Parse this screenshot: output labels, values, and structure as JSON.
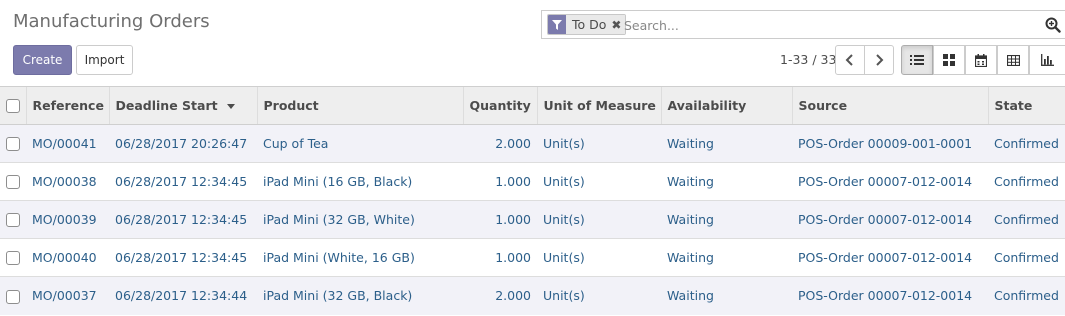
{
  "page": {
    "title": "Manufacturing Orders"
  },
  "buttons": {
    "create": "Create",
    "import": "Import"
  },
  "search": {
    "facet_value": "To Do",
    "facet_icon": "filter-icon",
    "placeholder": "Search...",
    "search_icon": "search-icon"
  },
  "pager": {
    "value": "1-33 / 33"
  },
  "views": [
    "list",
    "kanban",
    "calendar",
    "pivot",
    "graph"
  ],
  "active_view": "list",
  "colors": {
    "primary": "#7c7bad",
    "link": "#2c5f8a",
    "header_bg": "#eeeeee",
    "row_alt_bg": "#f2f2f8"
  },
  "table": {
    "columns": [
      "Reference",
      "Deadline Start",
      "Product",
      "Quantity",
      "Unit of Measure",
      "Availability",
      "Source",
      "State"
    ],
    "sorted_column": "Deadline Start",
    "sort_direction": "descending",
    "rows": [
      {
        "reference": "MO/00041",
        "deadline_start": "06/28/2017 20:26:47",
        "product": "Cup of Tea",
        "quantity": "2.000",
        "uom": "Unit(s)",
        "availability": "Waiting",
        "source": "POS-Order 00009-001-0001",
        "state": "Confirmed"
      },
      {
        "reference": "MO/00038",
        "deadline_start": "06/28/2017 12:34:45",
        "product": "iPad Mini (16 GB, Black)",
        "quantity": "1.000",
        "uom": "Unit(s)",
        "availability": "Waiting",
        "source": "POS-Order 00007-012-0014",
        "state": "Confirmed"
      },
      {
        "reference": "MO/00039",
        "deadline_start": "06/28/2017 12:34:45",
        "product": "iPad Mini (32 GB, White)",
        "quantity": "1.000",
        "uom": "Unit(s)",
        "availability": "Waiting",
        "source": "POS-Order 00007-012-0014",
        "state": "Confirmed"
      },
      {
        "reference": "MO/00040",
        "deadline_start": "06/28/2017 12:34:45",
        "product": "iPad Mini (White, 16 GB)",
        "quantity": "1.000",
        "uom": "Unit(s)",
        "availability": "Waiting",
        "source": "POS-Order 00007-012-0014",
        "state": "Confirmed"
      },
      {
        "reference": "MO/00037",
        "deadline_start": "06/28/2017 12:34:44",
        "product": "iPad Mini (32 GB, Black)",
        "quantity": "2.000",
        "uom": "Unit(s)",
        "availability": "Waiting",
        "source": "POS-Order 00007-012-0014",
        "state": "Confirmed"
      }
    ]
  }
}
